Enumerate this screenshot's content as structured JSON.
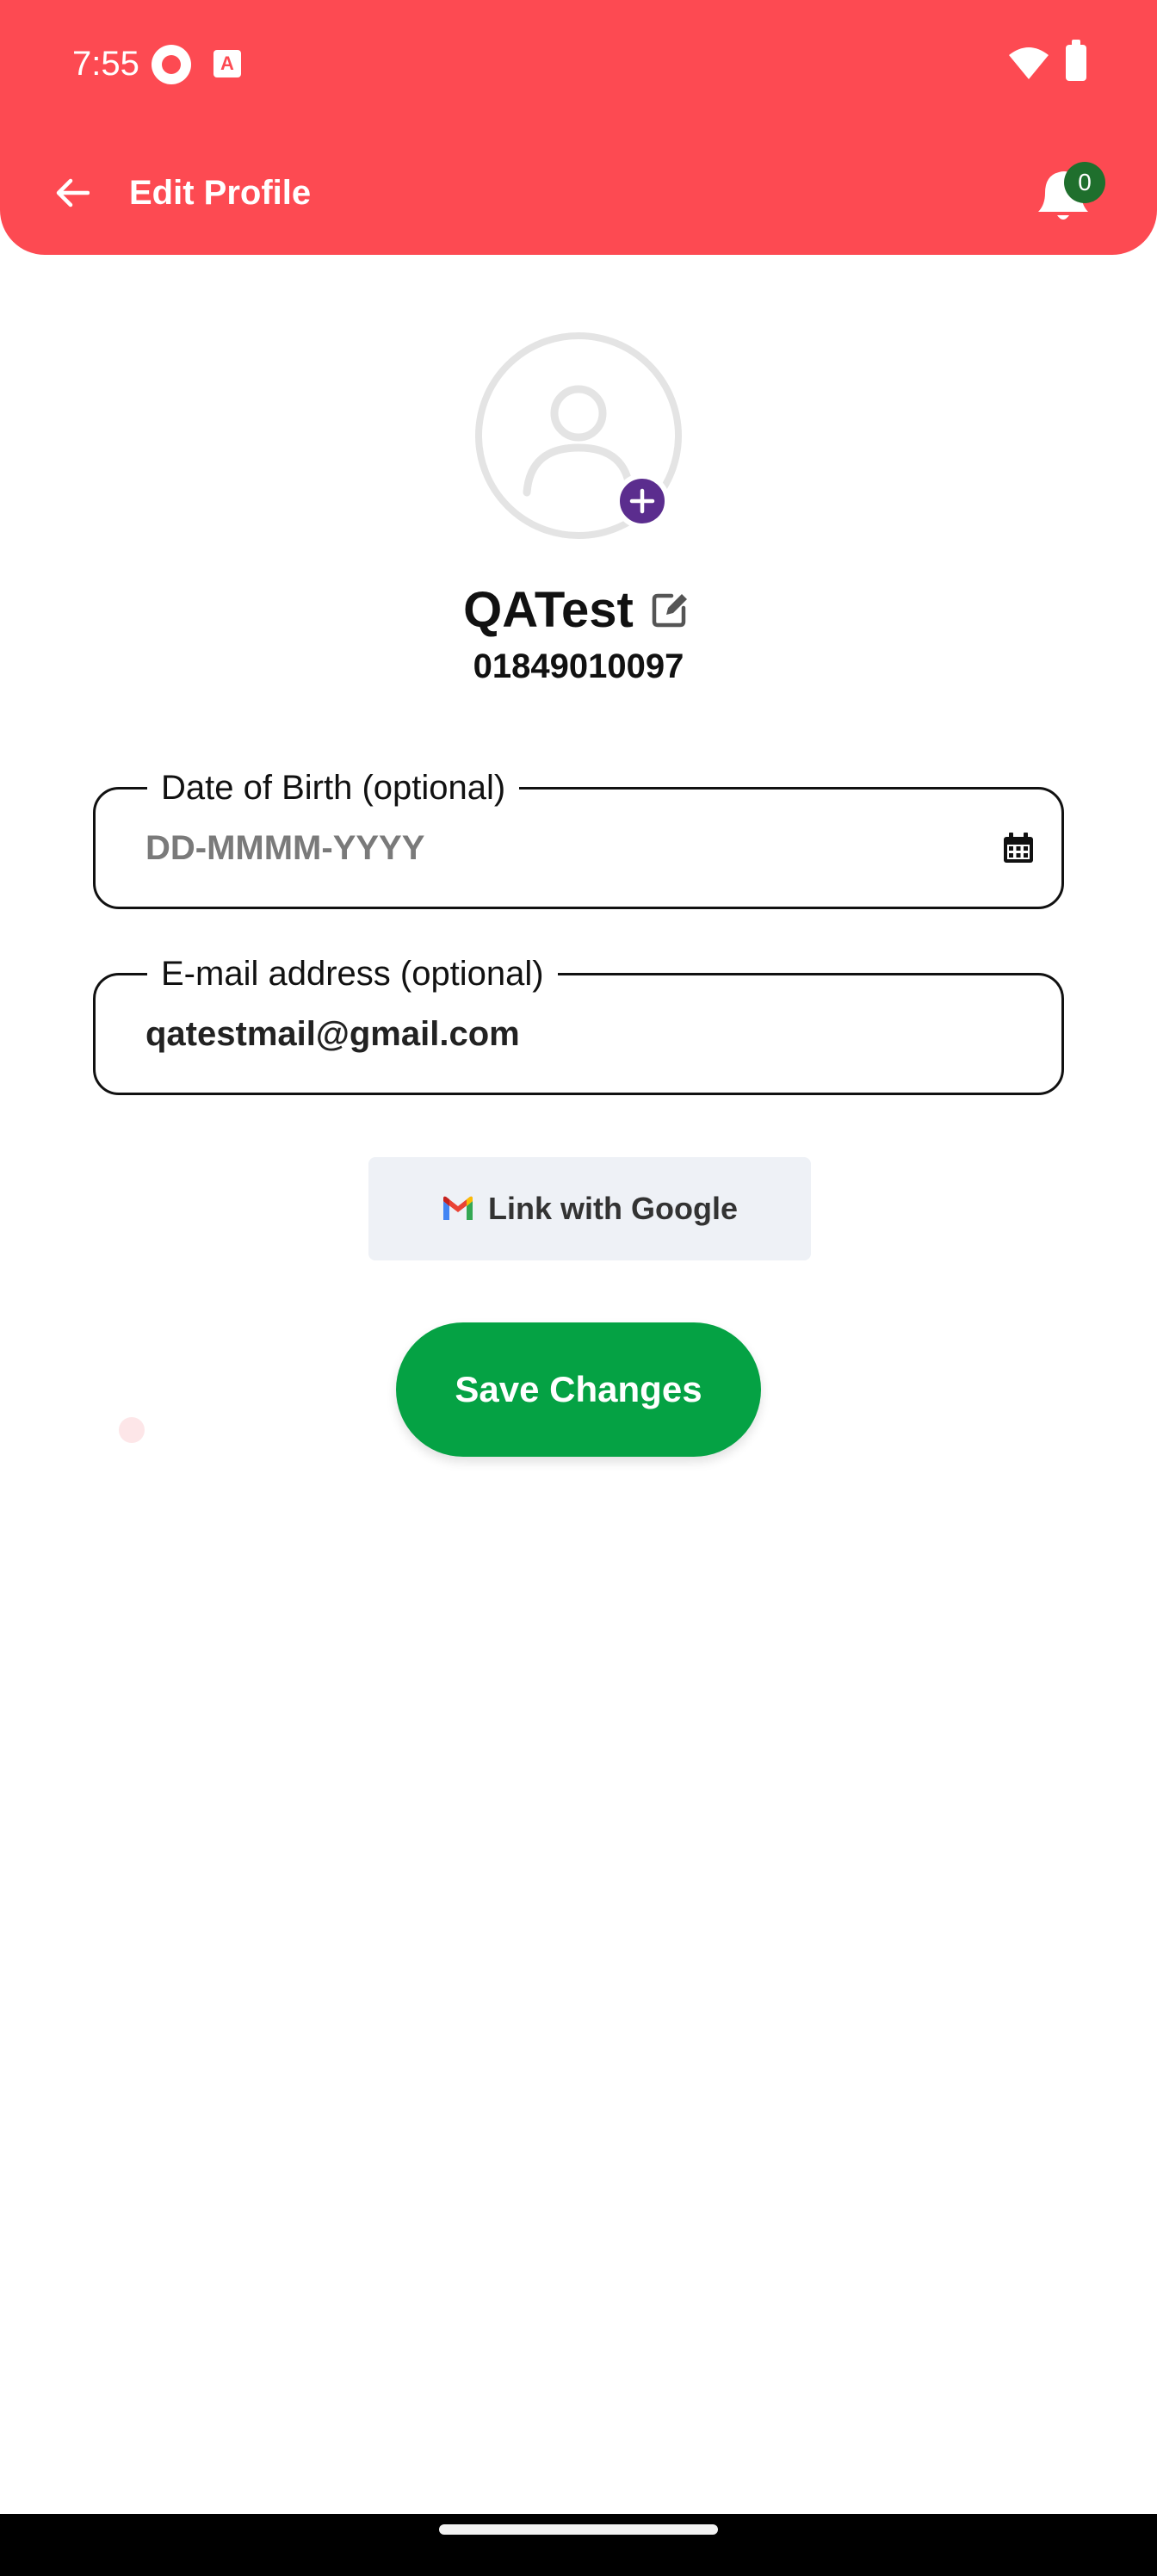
{
  "status_bar": {
    "time": "7:55",
    "app_badge_letter": "A"
  },
  "header": {
    "title": "Edit Profile",
    "notification_count": "0",
    "background_color": "#fd4a52"
  },
  "profile": {
    "name": "QATest",
    "phone": "01849010097"
  },
  "form": {
    "dob": {
      "label": "Date of Birth (optional)",
      "placeholder": "DD-MMMM-YYYY"
    },
    "email": {
      "label": "E-mail address (optional)",
      "value": "qatestmail@gmail.com"
    }
  },
  "buttons": {
    "link_google": "Link with Google",
    "save": "Save Changes"
  },
  "colors": {
    "accent_red": "#fd4a52",
    "save_green": "#05a244",
    "add_photo_purple": "#5b2d8e",
    "badge_green": "#1f6f2d"
  },
  "icons": [
    "back-arrow-icon",
    "bell-icon",
    "user-placeholder-icon",
    "plus-icon",
    "edit-icon",
    "calendar-icon",
    "gmail-icon",
    "wifi-icon",
    "battery-icon"
  ]
}
